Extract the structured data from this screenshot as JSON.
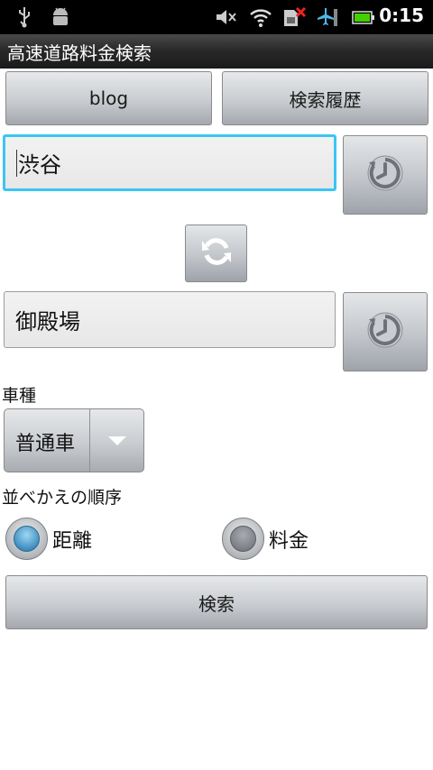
{
  "status_bar": {
    "time": "0:15",
    "icons": [
      "usb-icon",
      "android-debug-icon",
      "mute-icon",
      "wifi-icon",
      "sim-error-icon",
      "airplane-signal-icon",
      "battery-icon"
    ]
  },
  "title_bar": {
    "title": "高速道路料金検索"
  },
  "top_buttons": {
    "blog_label": "blog",
    "history_label": "検索履歴"
  },
  "origin": {
    "value": "渋谷"
  },
  "destination": {
    "value": "御殿場"
  },
  "vehicle": {
    "label": "車種",
    "selected": "普通車"
  },
  "sort": {
    "label": "並べかえの順序",
    "options": [
      {
        "label": "距離",
        "checked": true
      },
      {
        "label": "料金",
        "checked": false
      }
    ]
  },
  "search_button": {
    "label": "検索"
  },
  "colors": {
    "focus": "#39c6f2",
    "radio_on": "#3f8fc0",
    "titlebar": "#2a2a2a"
  }
}
